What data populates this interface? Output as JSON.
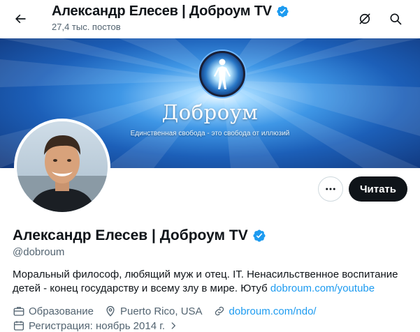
{
  "header": {
    "title": "Александр Елесев | Доброум TV",
    "post_count": "27,4 тыс. постов"
  },
  "banner": {
    "brand": "Доброум",
    "tagline": "Единственная свобода - это свобода от иллюзий"
  },
  "actions": {
    "follow_label": "Читать"
  },
  "profile": {
    "name": "Александр Елесев | Доброум TV",
    "handle": "@dobroum",
    "bio_text": "Моральный философ, любящий муж и отец. IT. Ненасильственное воспитание детей - конец государству и всему злу в мире. Ютуб ",
    "bio_link": "dobroum.com/youtube",
    "category": "Образование",
    "location": "Puerto Rico, USA",
    "website": "dobroum.com/ndo/",
    "joined": "Регистрация: ноябрь 2014 г."
  },
  "colors": {
    "accent": "#1d9bf0",
    "verified": "#1d9bf0",
    "text_primary": "#0f1419",
    "text_secondary": "#536471",
    "follow_button": "#0f1419"
  },
  "icons": {
    "back": "arrow-left-icon",
    "grok": "grok-icon",
    "search": "search-icon",
    "verified": "verified-badge-icon",
    "more": "more-horizontal-icon",
    "category": "briefcase-icon",
    "location": "location-pin-icon",
    "website": "link-icon",
    "joined": "calendar-icon",
    "joined_chevron": "chevron-right-icon"
  }
}
